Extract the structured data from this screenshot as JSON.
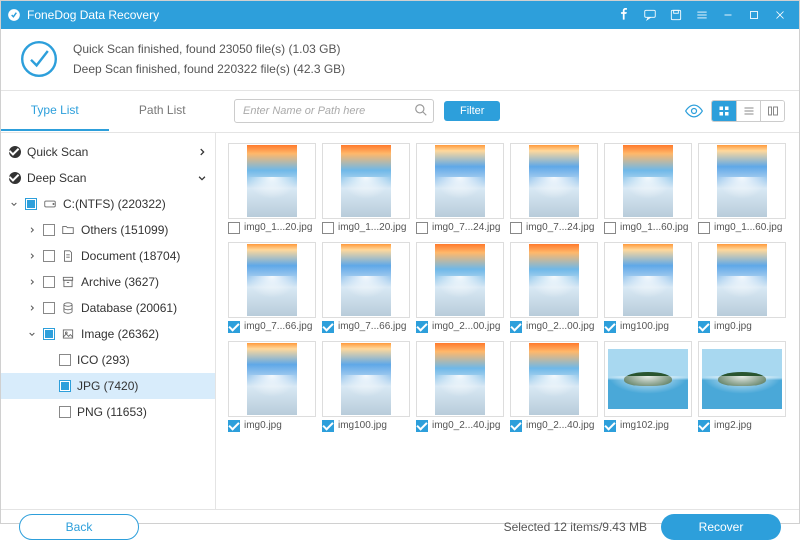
{
  "title": "FoneDog Data Recovery",
  "status": {
    "quick": "Quick Scan finished, found 23050 file(s) (1.03 GB)",
    "deep": "Deep Scan finished, found 220322 file(s) (42.3 GB)"
  },
  "tabs": {
    "type": "Type List",
    "path": "Path List"
  },
  "search": {
    "placeholder": "Enter Name or Path here"
  },
  "filter": "Filter",
  "tree": {
    "quick": "Quick Scan",
    "deep": "Deep Scan",
    "drive": "C:(NTFS) (220322)",
    "others": "Others (151099)",
    "document": "Document (18704)",
    "archive": "Archive (3627)",
    "database": "Database (20061)",
    "image": "Image (26362)",
    "ico": "ICO (293)",
    "jpg": "JPG (7420)",
    "png": "PNG (11653)"
  },
  "grid": [
    [
      {
        "name": "img0_1...20.jpg",
        "checked": false,
        "style": "sunset"
      },
      {
        "name": "img0_1...20.jpg",
        "checked": false,
        "style": "sunset"
      },
      {
        "name": "img0_7...24.jpg",
        "checked": false,
        "style": ""
      },
      {
        "name": "img0_7...24.jpg",
        "checked": false,
        "style": ""
      },
      {
        "name": "img0_1...60.jpg",
        "checked": false,
        "style": "sunset"
      },
      {
        "name": "img0_1...60.jpg",
        "checked": false,
        "style": ""
      }
    ],
    [
      {
        "name": "img0_7...66.jpg",
        "checked": true,
        "style": ""
      },
      {
        "name": "img0_7...66.jpg",
        "checked": true,
        "style": ""
      },
      {
        "name": "img0_2...00.jpg",
        "checked": true,
        "style": "sunset"
      },
      {
        "name": "img0_2...00.jpg",
        "checked": true,
        "style": "sunset"
      },
      {
        "name": "img100.jpg",
        "checked": true,
        "style": ""
      },
      {
        "name": "img0.jpg",
        "checked": true,
        "style": ""
      }
    ],
    [
      {
        "name": "img0.jpg",
        "checked": true,
        "style": ""
      },
      {
        "name": "img100.jpg",
        "checked": true,
        "style": ""
      },
      {
        "name": "img0_2...40.jpg",
        "checked": true,
        "style": "sunset"
      },
      {
        "name": "img0_2...40.jpg",
        "checked": true,
        "style": "sunset"
      },
      {
        "name": "img102.jpg",
        "checked": true,
        "style": "island"
      },
      {
        "name": "img2.jpg",
        "checked": true,
        "style": "island"
      }
    ]
  ],
  "footer": {
    "back": "Back",
    "selected": "Selected 12 items/9.43 MB",
    "recover": "Recover"
  }
}
